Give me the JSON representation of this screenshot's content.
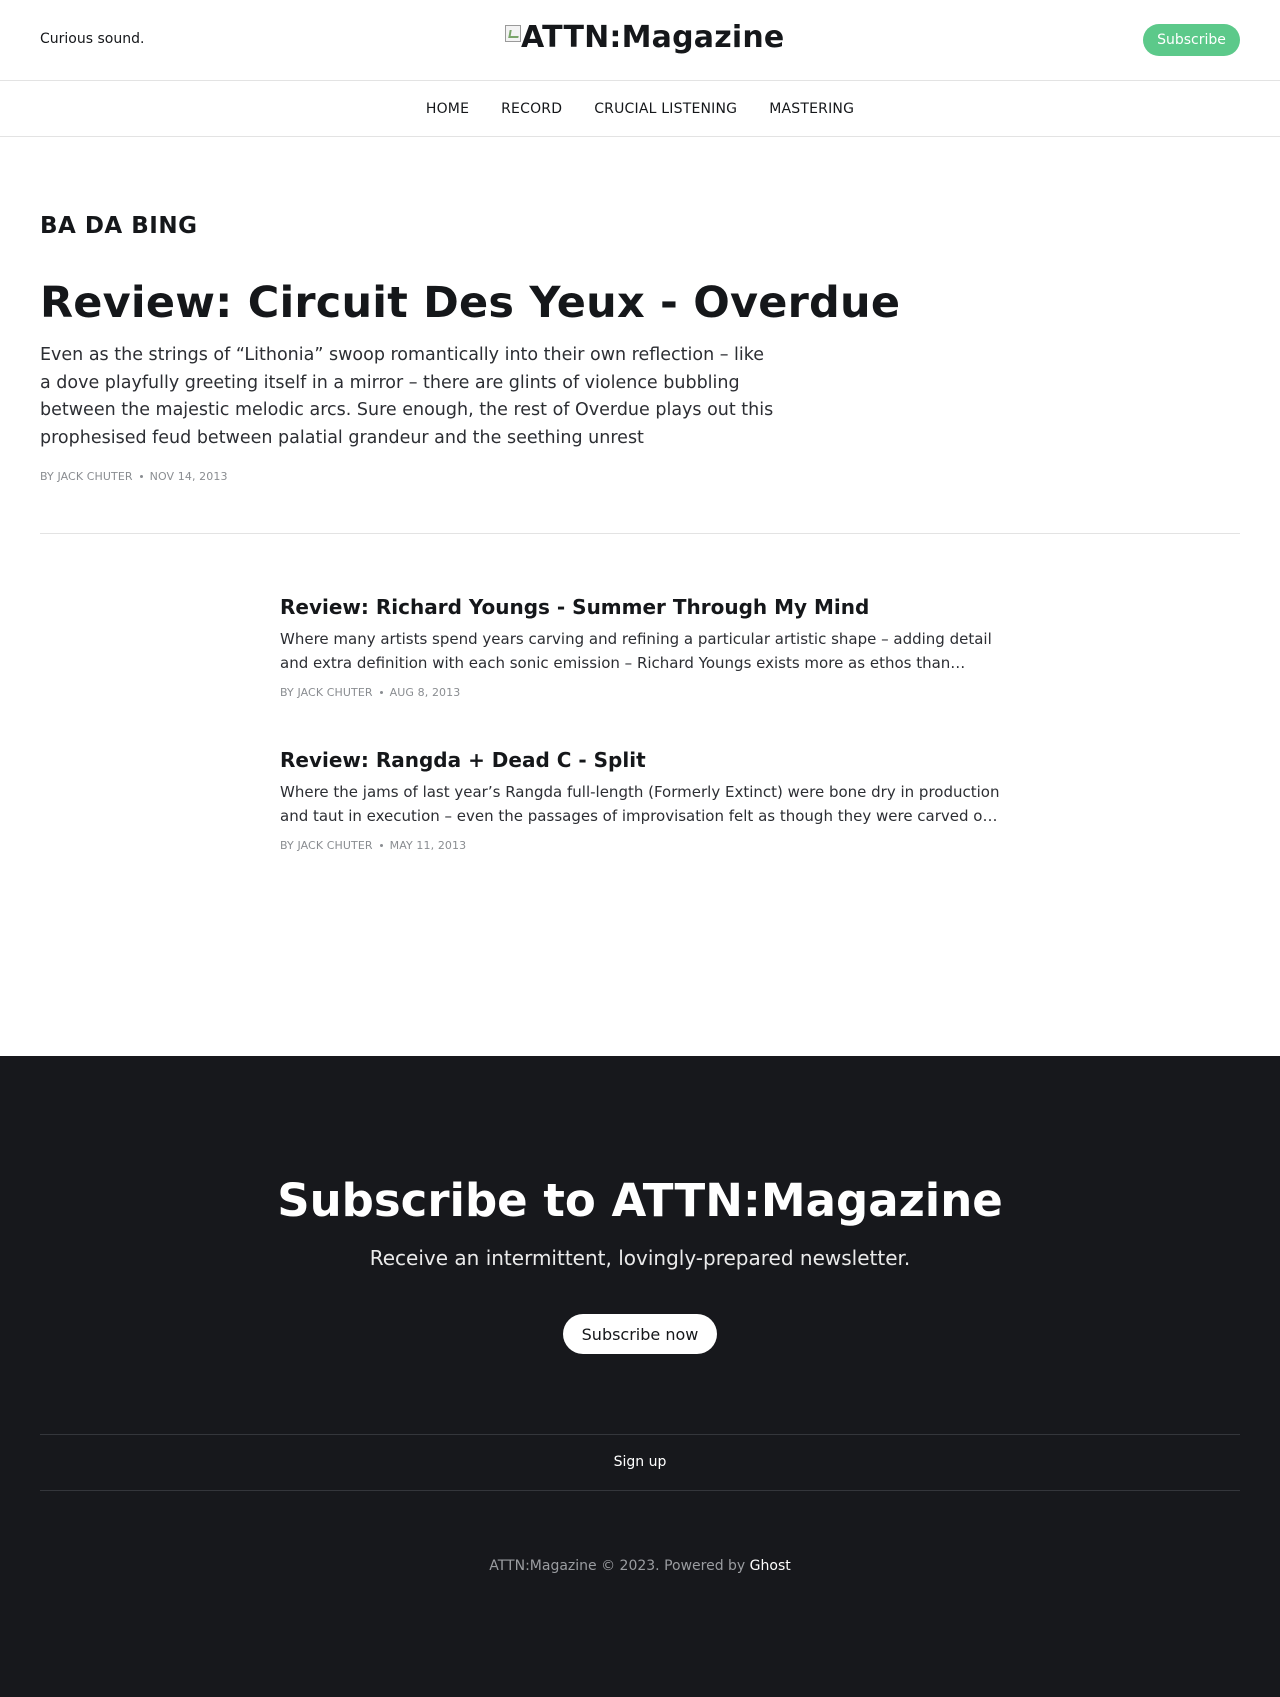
{
  "header": {
    "tagline": "Curious sound.",
    "logo_text": "ATTN:Magazine",
    "subscribe_label": "Subscribe"
  },
  "nav": {
    "items": [
      {
        "label": "HOME"
      },
      {
        "label": "RECORD"
      },
      {
        "label": "CRUCIAL LISTENING"
      },
      {
        "label": "MASTERING"
      }
    ]
  },
  "tag": {
    "title": "BA DA BING"
  },
  "featured": {
    "title": "Review: Circuit Des Yeux - Overdue",
    "excerpt": "Even as the strings of “Lithonia” swoop romantically into their own reflection – like a dove playfully greeting itself in a mirror – there are glints of violence bubbling between the majestic melodic arcs. Sure enough, the rest of Overdue plays out this prophesised feud between palatial grandeur and the seething unrest",
    "author": "BY JACK CHUTER",
    "date": "NOV 14, 2013"
  },
  "posts": [
    {
      "title": "Review: Richard Youngs - Summer Through My Mind",
      "excerpt": "Where many artists spend years carving and refining a particular artistic shape – adding detail and extra definition with each sonic emission – Richard Youngs exists more as ethos than…",
      "author": "BY JACK CHUTER",
      "date": "AUG 8, 2013"
    },
    {
      "title": "Review: Rangda + Dead C - Split",
      "excerpt": "Where the jams of last year’s Rangda full-length (Formerly Extinct) were bone dry in production and taut in execution – even the passages of improvisation felt as though they were carved o…",
      "author": "BY JACK CHUTER",
      "date": "MAY 11, 2013"
    }
  ],
  "footer": {
    "cta_title": "Subscribe to ATTN:Magazine",
    "cta_subtitle": "Receive an intermittent, lovingly-prepared newsletter.",
    "cta_button": "Subscribe now",
    "nav_link": "Sign up",
    "copyright": "ATTN:Magazine © 2023. Powered by ",
    "powered_by": "Ghost"
  },
  "colors": {
    "accent": "#5cc98a",
    "footer_bg": "#17181c"
  }
}
